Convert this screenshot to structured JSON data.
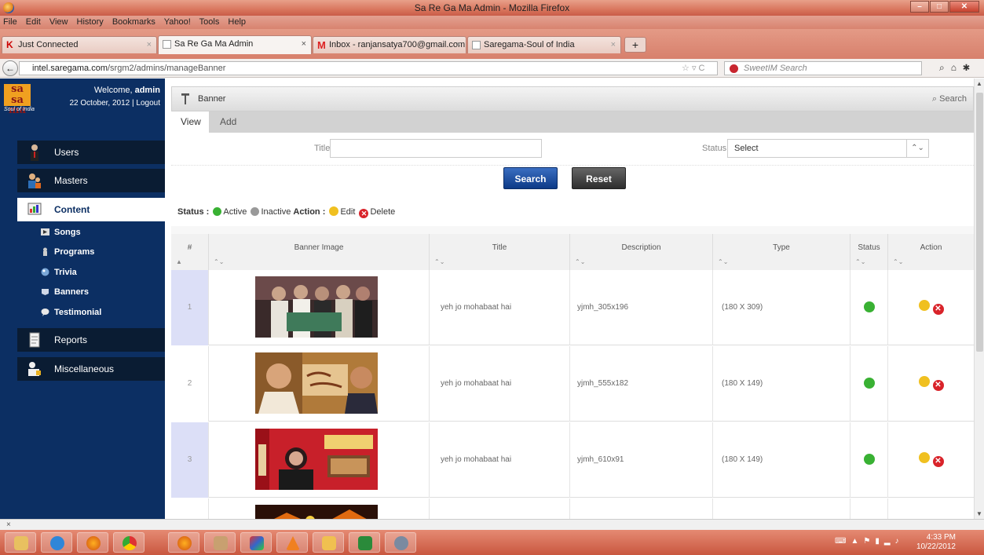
{
  "window": {
    "title": "Sa Re Ga Ma Admin - Mozilla Firefox"
  },
  "menu": [
    "File",
    "Edit",
    "View",
    "History",
    "Bookmarks",
    "Yahoo!",
    "Tools",
    "Help"
  ],
  "tabs": [
    {
      "label": "Just Connected"
    },
    {
      "label": "Sa Re Ga Ma Admin"
    },
    {
      "label": "Inbox - ranjansatya700@gmail.com - ..."
    },
    {
      "label": "Saregama-Soul of India"
    }
  ],
  "newtab": "+",
  "url": {
    "domain": "intel.saregama.com",
    "path": "/srgm2/admins/manageBanner"
  },
  "browser_search": {
    "placeholder": "SweetIM Search"
  },
  "logo": {
    "line1": "sa re",
    "line2": "sa ma",
    "tagline": "Soul of India"
  },
  "welcome": {
    "text": "Welcome,",
    "user": "admin",
    "date": "22 October, 2012",
    "separator": "|",
    "logout": "Logout"
  },
  "sidebar": {
    "main": [
      {
        "label": "Users"
      },
      {
        "label": "Masters"
      },
      {
        "label": "Content"
      },
      {
        "label": "Reports"
      },
      {
        "label": "Miscellaneous"
      }
    ],
    "sub": [
      {
        "label": "Songs"
      },
      {
        "label": "Programs"
      },
      {
        "label": "Trivia"
      },
      {
        "label": "Banners"
      },
      {
        "label": "Testimonial"
      }
    ]
  },
  "page": {
    "heading": "Banner",
    "search_link": "Search",
    "tab_view": "View",
    "tab_add": "Add",
    "title_label": "Title",
    "status_label": "Status",
    "status_value": "Select",
    "search_btn": "Search",
    "reset_btn": "Reset"
  },
  "legend": {
    "status": "Status :",
    "active": "Active",
    "inactive": "Inactive",
    "action": "Action :",
    "edit": "Edit",
    "delete": "Delete"
  },
  "table": {
    "headers": [
      "#",
      "Banner Image",
      "Title",
      "Description",
      "Type",
      "Status",
      "Action"
    ],
    "rows": [
      {
        "num": "1",
        "title": "yeh jo mohabaat hai",
        "description": "yjmh_305x196",
        "type": "(180 X 309)"
      },
      {
        "num": "2",
        "title": "yeh jo mohabaat hai",
        "description": "yjmh_555x182",
        "type": "(180 X 149)"
      },
      {
        "num": "3",
        "title": "yeh jo mohabaat hai",
        "description": "yjmh_610x91",
        "type": "(180 X 149)"
      }
    ]
  },
  "statusbar": {
    "close": "×"
  },
  "tray": {
    "time": "4:33 PM",
    "date": "10/22/2012"
  },
  "colors": {
    "sidebar": "#0c2f63",
    "active_status": "#39b133",
    "search_button": "#0d3a87",
    "titlebar": "#d9765e"
  }
}
